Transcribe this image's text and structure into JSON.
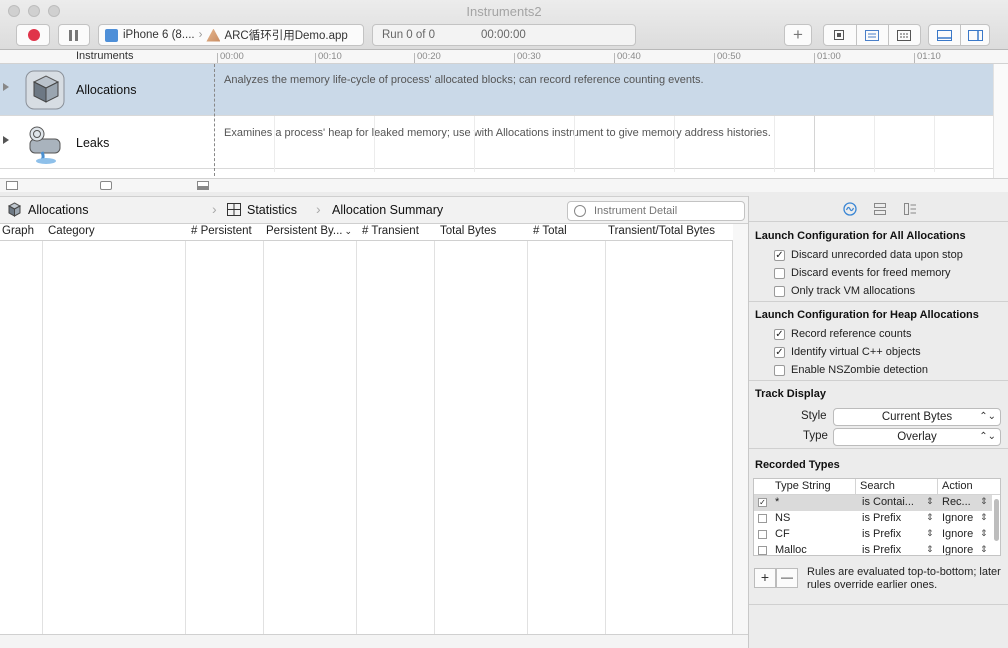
{
  "window": {
    "title": "Instruments2"
  },
  "toolbar": {
    "target_device": "iPhone 6 (8....",
    "target_app": "ARC循环引用Demo.app",
    "run_label": "Run 0 of 0",
    "run_time": "00:00:00",
    "add_label": "+"
  },
  "timeline": {
    "header_label": "Instruments",
    "ticks": [
      "00:00",
      "00:10",
      "00:20",
      "00:30",
      "00:40",
      "00:50",
      "01:00",
      "01:10"
    ],
    "tracks": [
      {
        "name": "Allocations",
        "description": "Analyzes the memory life-cycle of process' allocated blocks; can record reference counting events."
      },
      {
        "name": "Leaks",
        "description": "Examines a process' heap for leaked memory; use with Allocations instrument to give memory address histories."
      }
    ]
  },
  "detail": {
    "breadcrumb": [
      "Allocations",
      "Statistics",
      "Allocation Summary"
    ],
    "search_placeholder": "Instrument Detail",
    "columns": [
      "Graph",
      "Category",
      "# Persistent",
      "Persistent By...",
      "# Transient",
      "Total Bytes",
      "# Total",
      "Transient/Total Bytes"
    ]
  },
  "inspector": {
    "launch_all": {
      "title": "Launch Configuration for All Allocations",
      "options": [
        {
          "label": "Discard unrecorded data upon stop",
          "checked": true
        },
        {
          "label": "Discard events for freed memory",
          "checked": false
        },
        {
          "label": "Only track VM allocations",
          "checked": false
        }
      ]
    },
    "launch_heap": {
      "title": "Launch Configuration for Heap Allocations",
      "options": [
        {
          "label": "Record reference counts",
          "checked": true
        },
        {
          "label": "Identify virtual C++ objects",
          "checked": true
        },
        {
          "label": "Enable NSZombie detection",
          "checked": false
        }
      ]
    },
    "track_display": {
      "title": "Track Display",
      "style_label": "Style",
      "style_value": "Current Bytes",
      "type_label": "Type",
      "type_value": "Overlay"
    },
    "recorded_types": {
      "title": "Recorded Types",
      "columns": [
        "Type String",
        "Search",
        "Action"
      ],
      "rows": [
        {
          "checked": true,
          "type": "*",
          "search": "is Contai...",
          "action": "Rec..."
        },
        {
          "checked": false,
          "type": "NS",
          "search": "is Prefix",
          "action": "Ignore"
        },
        {
          "checked": false,
          "type": "CF",
          "search": "is Prefix",
          "action": "Ignore"
        },
        {
          "checked": false,
          "type": "Malloc",
          "search": "is Prefix",
          "action": "Ignore"
        }
      ],
      "note": "Rules are evaluated top-to-bottom; later rules override earlier ones.",
      "add_label": "+",
      "remove_label": "—"
    }
  }
}
